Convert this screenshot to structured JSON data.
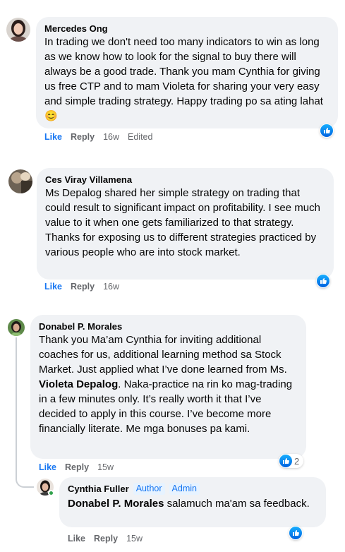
{
  "comments": [
    {
      "author": "Mercedes Ong",
      "text": "In trading we don't need too many indicators to win as long as we know how to look for the signal to buy there will always be a good trade. Thank you mam Cynthia for giving us free CTP and to mam Violeta for sharing your very easy and simple trading strategy. Happy trading po sa ating lahat",
      "emoji": "😊",
      "like_label": "Like",
      "reply_label": "Reply",
      "time": "16w",
      "edited": "Edited"
    },
    {
      "author": "Ces Viray Villamena",
      "text": "Ms Depalog shared her simple strategy on trading that could result to significant impact on profitability. I see much value to it when one gets familiarized to that strategy.\nThanks for exposing us to different strategies practiced by various people who are into stock market.",
      "like_label": "Like",
      "reply_label": "Reply",
      "time": "16w"
    },
    {
      "author": "Donabel P. Morales",
      "text_a": "Thank you Ma’am Cynthia for inviting additional coaches for us, additional learning method sa Stock Market. Just applied what I’ve done learned from Ms. ",
      "text_bold": "Violeta Depalog",
      "text_b": ". Naka-practice na rin ko mag-trading in a few minutes only. It’s really worth it that I’ve decided to apply in this course. I’ve become more financially literate. Me mga bonuses pa kami.",
      "like_label": "Like",
      "reply_label": "Reply",
      "time": "15w",
      "reaction_count": "2"
    }
  ],
  "reply": {
    "author": "Cynthia Fuller",
    "tag_author": "Author",
    "tag_admin": "Admin",
    "mention": "Donabel P. Morales",
    "text": " salamuch ma'am sa feedback.",
    "like_label": "Like",
    "reply_label": "Reply",
    "time": "15w"
  },
  "colors": {
    "link": "#1877f2",
    "bubble": "#f0f2f5",
    "meta": "#65676b",
    "online": "#31a24c"
  }
}
